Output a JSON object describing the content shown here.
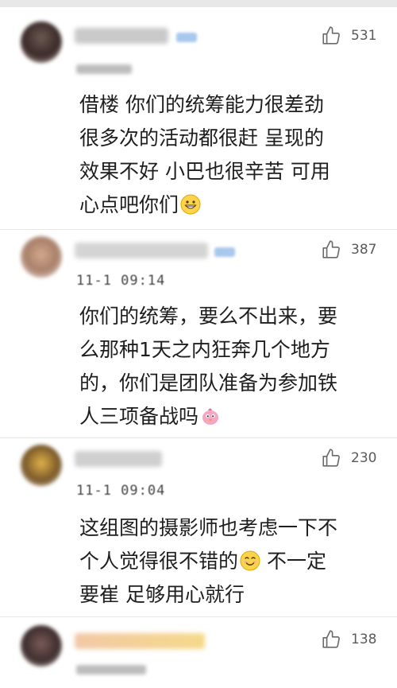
{
  "comments": [
    {
      "username": "",
      "timestamp": "",
      "likes": "531",
      "text_lines": [
        "借楼 你们的统筹能力很差劲",
        "很多次的活动都很赶 呈现的",
        "效果不好 小巴也很辛苦 可用",
        "心点吧你们"
      ],
      "emoji": "grinning-face-emoji"
    },
    {
      "username": "",
      "timestamp": "11-1 09:14",
      "likes": "387",
      "text_lines": [
        "你们的统筹，要么不出来，要",
        "么那种1天之内狂奔几个地方",
        "的，你们是团队准备为参加铁",
        "人三项备战吗"
      ],
      "emoji": "pink-bird-emoji"
    },
    {
      "username": "",
      "timestamp": "11-1 09:04",
      "likes": "230",
      "text_lines": [
        "这组图的摄影师也考虑一下不",
        "个人觉得很不错的",
        "要崔 足够用心就行"
      ],
      "line2_suffix": " 不一定",
      "emoji": "smiling-face-emoji"
    },
    {
      "username": "",
      "timestamp": "",
      "likes": "138",
      "text_lines": []
    }
  ],
  "icons": {
    "like": "thumbs-up-icon"
  },
  "colors": {
    "background": "#f2f2f2",
    "card": "#ffffff",
    "text": "#1e1e1e",
    "meta": "#5a5a5a"
  }
}
